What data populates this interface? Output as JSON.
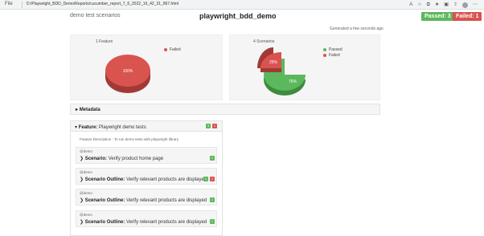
{
  "browser": {
    "info_label": "File",
    "url": "D:/Playwright_BDD_Demo/Reports/cucumber_report_7_6_2022_16_42_31_867.html"
  },
  "header": {
    "project_name": "demo test scenarios",
    "title": "playwright_bdd_demo",
    "passed_badge": "Passed: 3",
    "failed_badge": "Failed: 1",
    "generated": "Generated a few seconds ago"
  },
  "colors": {
    "passed": "#5cb85c",
    "failed": "#d9534f"
  },
  "charts": {
    "features": {
      "title": "1 Feature",
      "legend": [
        "Failed"
      ],
      "slice_label": "100%"
    },
    "scenarios": {
      "title": "4 Scenarios",
      "legend": [
        "Passed",
        "Failed"
      ],
      "passed_label": "75%",
      "failed_label": "25%"
    }
  },
  "chart_data": [
    {
      "type": "pie",
      "title": "1 Feature",
      "categories": [
        "Failed"
      ],
      "values": [
        100
      ]
    },
    {
      "type": "pie",
      "title": "4 Scenarios",
      "categories": [
        "Passed",
        "Failed"
      ],
      "values": [
        75,
        25
      ]
    }
  ],
  "metadata": {
    "label": "Metadata"
  },
  "feature": {
    "keyword": "Feature:",
    "name": "Playwright demo tests",
    "pass_count": "3",
    "fail_count": "1",
    "description": "Feature Description : To run demo tests with playwright library",
    "scenarios": [
      {
        "tag": "@demo",
        "keyword": "Scenario:",
        "name": "Verify product home page",
        "pass": "1"
      },
      {
        "tag": "@demo",
        "keyword": "Scenario Outline:",
        "name": "Verify relevant products are displayed",
        "pass": "1",
        "fail": "1"
      },
      {
        "tag": "@demo",
        "keyword": "Scenario Outline:",
        "name": "Verify relevant products are displayed",
        "pass": "1"
      },
      {
        "tag": "@demo",
        "keyword": "Scenario Outline:",
        "name": "Verify relevant products are displayed",
        "pass": "1"
      }
    ]
  }
}
